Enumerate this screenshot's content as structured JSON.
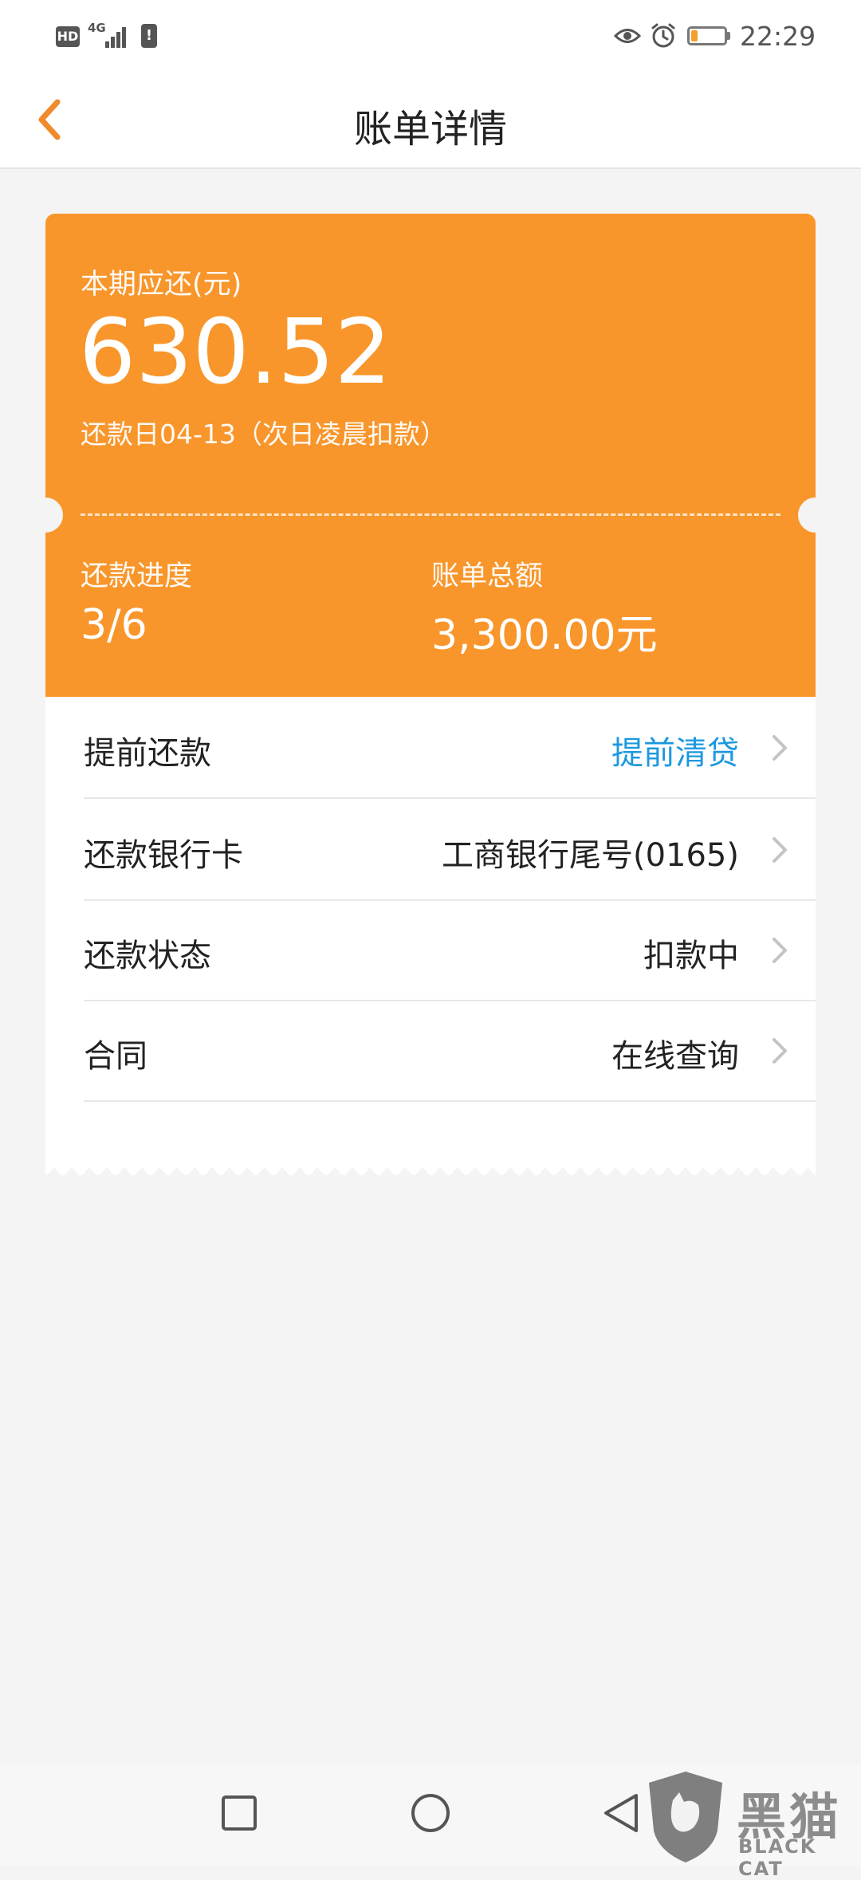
{
  "status_bar": {
    "hd": "HD",
    "network": "4G",
    "alert": "!",
    "time": "22:29",
    "battery_level": 0.2
  },
  "nav": {
    "title": "账单详情"
  },
  "summary": {
    "due_label": "本期应还(元)",
    "due_amount": "630.52",
    "due_date": "还款日04-13（次日凌晨扣款）",
    "progress_label": "还款进度",
    "progress_value": "3/6",
    "total_label": "账单总额",
    "total_value": "3,300.00元"
  },
  "details": {
    "rows": [
      {
        "label": "提前还款",
        "value": "提前清贷"
      },
      {
        "label": "还款银行卡",
        "value": "工商银行尾号(0165)"
      },
      {
        "label": "还款状态",
        "value": "扣款中"
      },
      {
        "label": "合同",
        "value": "在线查询"
      }
    ]
  },
  "watermark": {
    "title": "黑猫",
    "subtitle": "BLACK CAT"
  },
  "colors": {
    "accent": "#f8962b",
    "link": "#1b98de",
    "back_arrow": "#f08a2a"
  }
}
